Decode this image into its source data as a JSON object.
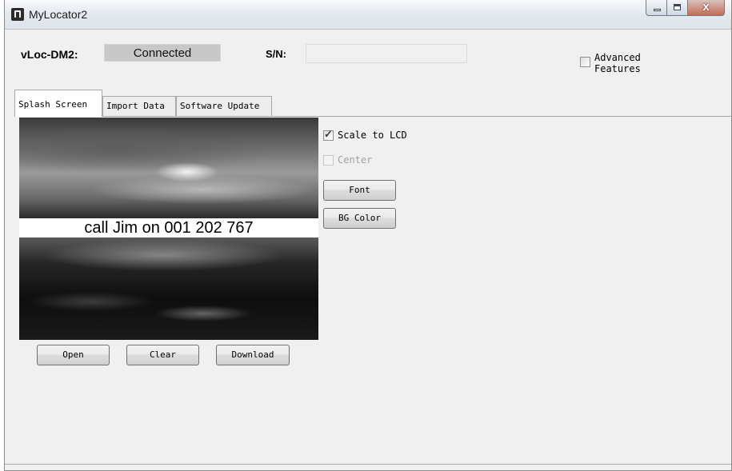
{
  "window": {
    "title": "MyLocator2"
  },
  "header": {
    "device_label": "vLoc-DM2:",
    "status_value": "Connected",
    "sn_label": "S/N:",
    "sn_value": "",
    "advanced_label_line1": "Advanced",
    "advanced_label_line2": "Features",
    "advanced_checked": false
  },
  "tabs": [
    {
      "label": "Splash Screen",
      "active": true
    },
    {
      "label": "Import Data",
      "active": false
    },
    {
      "label": "Software Update",
      "active": false
    }
  ],
  "splash": {
    "banner_text": "call Jim on 001 202 767",
    "options": {
      "scale_label": "Scale to LCD",
      "scale_checked": true,
      "center_label": "Center",
      "center_checked": false,
      "center_enabled": false
    },
    "buttons": {
      "font": "Font",
      "bg_color": "BG Color",
      "open": "Open",
      "clear": "Clear",
      "download": "Download"
    }
  },
  "caption_buttons": {
    "close_glyph": "x"
  }
}
